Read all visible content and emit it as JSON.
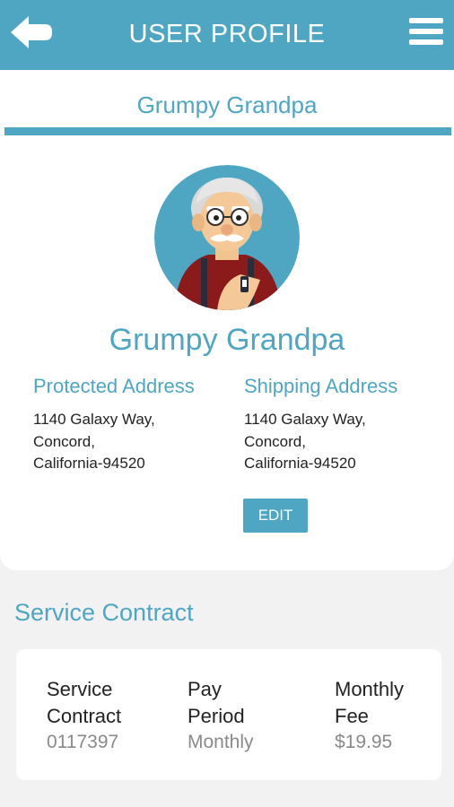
{
  "header": {
    "title": "USER PROFILE",
    "back_icon": "back-arrow-icon",
    "menu_icon": "hamburger-menu-icon"
  },
  "profile": {
    "tab_name": "Grumpy Grandpa",
    "name": "Grumpy Grandpa",
    "avatar_icon": "cartoon-grandpa-avatar",
    "protected_address": {
      "label": "Protected Address",
      "lines": [
        "1140 Galaxy Way,",
        "Concord,",
        "California-94520"
      ]
    },
    "shipping_address": {
      "label": "Shipping Address",
      "lines": [
        "1140 Galaxy Way,",
        "Concord,",
        "California-94520"
      ]
    },
    "edit_label": "EDIT"
  },
  "service_contract": {
    "heading": "Service Contract",
    "columns": [
      {
        "header": "Service Contract",
        "value": "0117397"
      },
      {
        "header": "Pay Period",
        "value": "Monthly"
      },
      {
        "header": "Monthly Fee",
        "value": "$19.95"
      }
    ]
  },
  "colors": {
    "accent": "#4fa6c3",
    "background": "#f2f2f2",
    "text": "#222222",
    "muted": "#8a8a8a"
  }
}
